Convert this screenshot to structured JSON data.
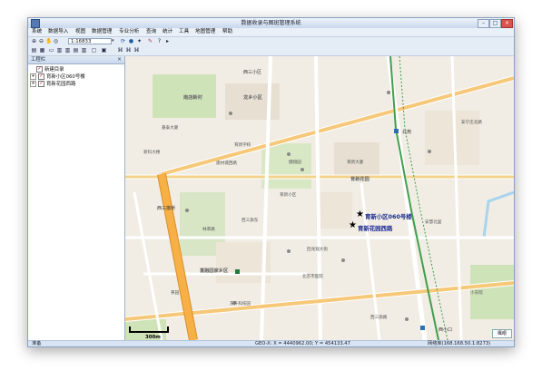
{
  "window": {
    "title": "数据收录与图斑管理系统"
  },
  "menu": [
    "系统",
    "数据导入",
    "视图",
    "数据管理",
    "专业分析",
    "查询",
    "统计",
    "工具",
    "地图管理",
    "帮助"
  ],
  "toolbar": {
    "scale_value": "1:16833"
  },
  "panel": {
    "title": "工程栏",
    "items": [
      {
        "label": "新建目录",
        "expander": "",
        "checked": false
      },
      {
        "label": "育新小区060号楼",
        "expander": "+",
        "checked": true
      },
      {
        "label": "育新花园西路",
        "expander": "+",
        "checked": true
      }
    ]
  },
  "map": {
    "markers": [
      {
        "label": "育新小区060号楼"
      },
      {
        "label": "育新花园西路"
      }
    ],
    "labels": {
      "nankou_xincun": "南店新村",
      "longxiang": "龙乡小区",
      "yuxin_garden": "育新花园",
      "xisanqi_bridge": "西三旗桥",
      "fuluyuan": "富融园家乡区",
      "xisanqi_west": "西三小区",
      "jiankang": "健翔园",
      "yuxin_daxi": "育新大厦",
      "xiaokou": "西小口",
      "yuxin_park": "育新小区",
      "jiatai": "嘉泰大厦",
      "beiyuan": "北苑",
      "huilongguan": "回龙观大街",
      "jianxiang_road": "建材城西路",
      "xisanqi_xinlu": "西三旗路",
      "anning": "安宁庄北路",
      "lin": "林萃路",
      "yuxin_school": "育新学校",
      "chayuan": "茶园",
      "hospital": "北京市医院",
      "bus": "西三旗东",
      "xinke": "新科大楼",
      "anhui": "安慧北里",
      "xiaodong": "小东院",
      "dongsheng": "东升科技园"
    },
    "scale_text": "300m",
    "overview_label": "鹰眼"
  },
  "status": {
    "left": "准备",
    "coords": "GEO-X: X = 4440962.00; Y = 454133.47",
    "net": "网络库(168.168.50.1:8273)"
  },
  "colors": {
    "highway": "#f7b045",
    "road": "#ffffff",
    "rail": "#3f9f4a",
    "green": "#cfe3b9",
    "block": "#e6dfd2",
    "river": "#a7d4ee"
  }
}
